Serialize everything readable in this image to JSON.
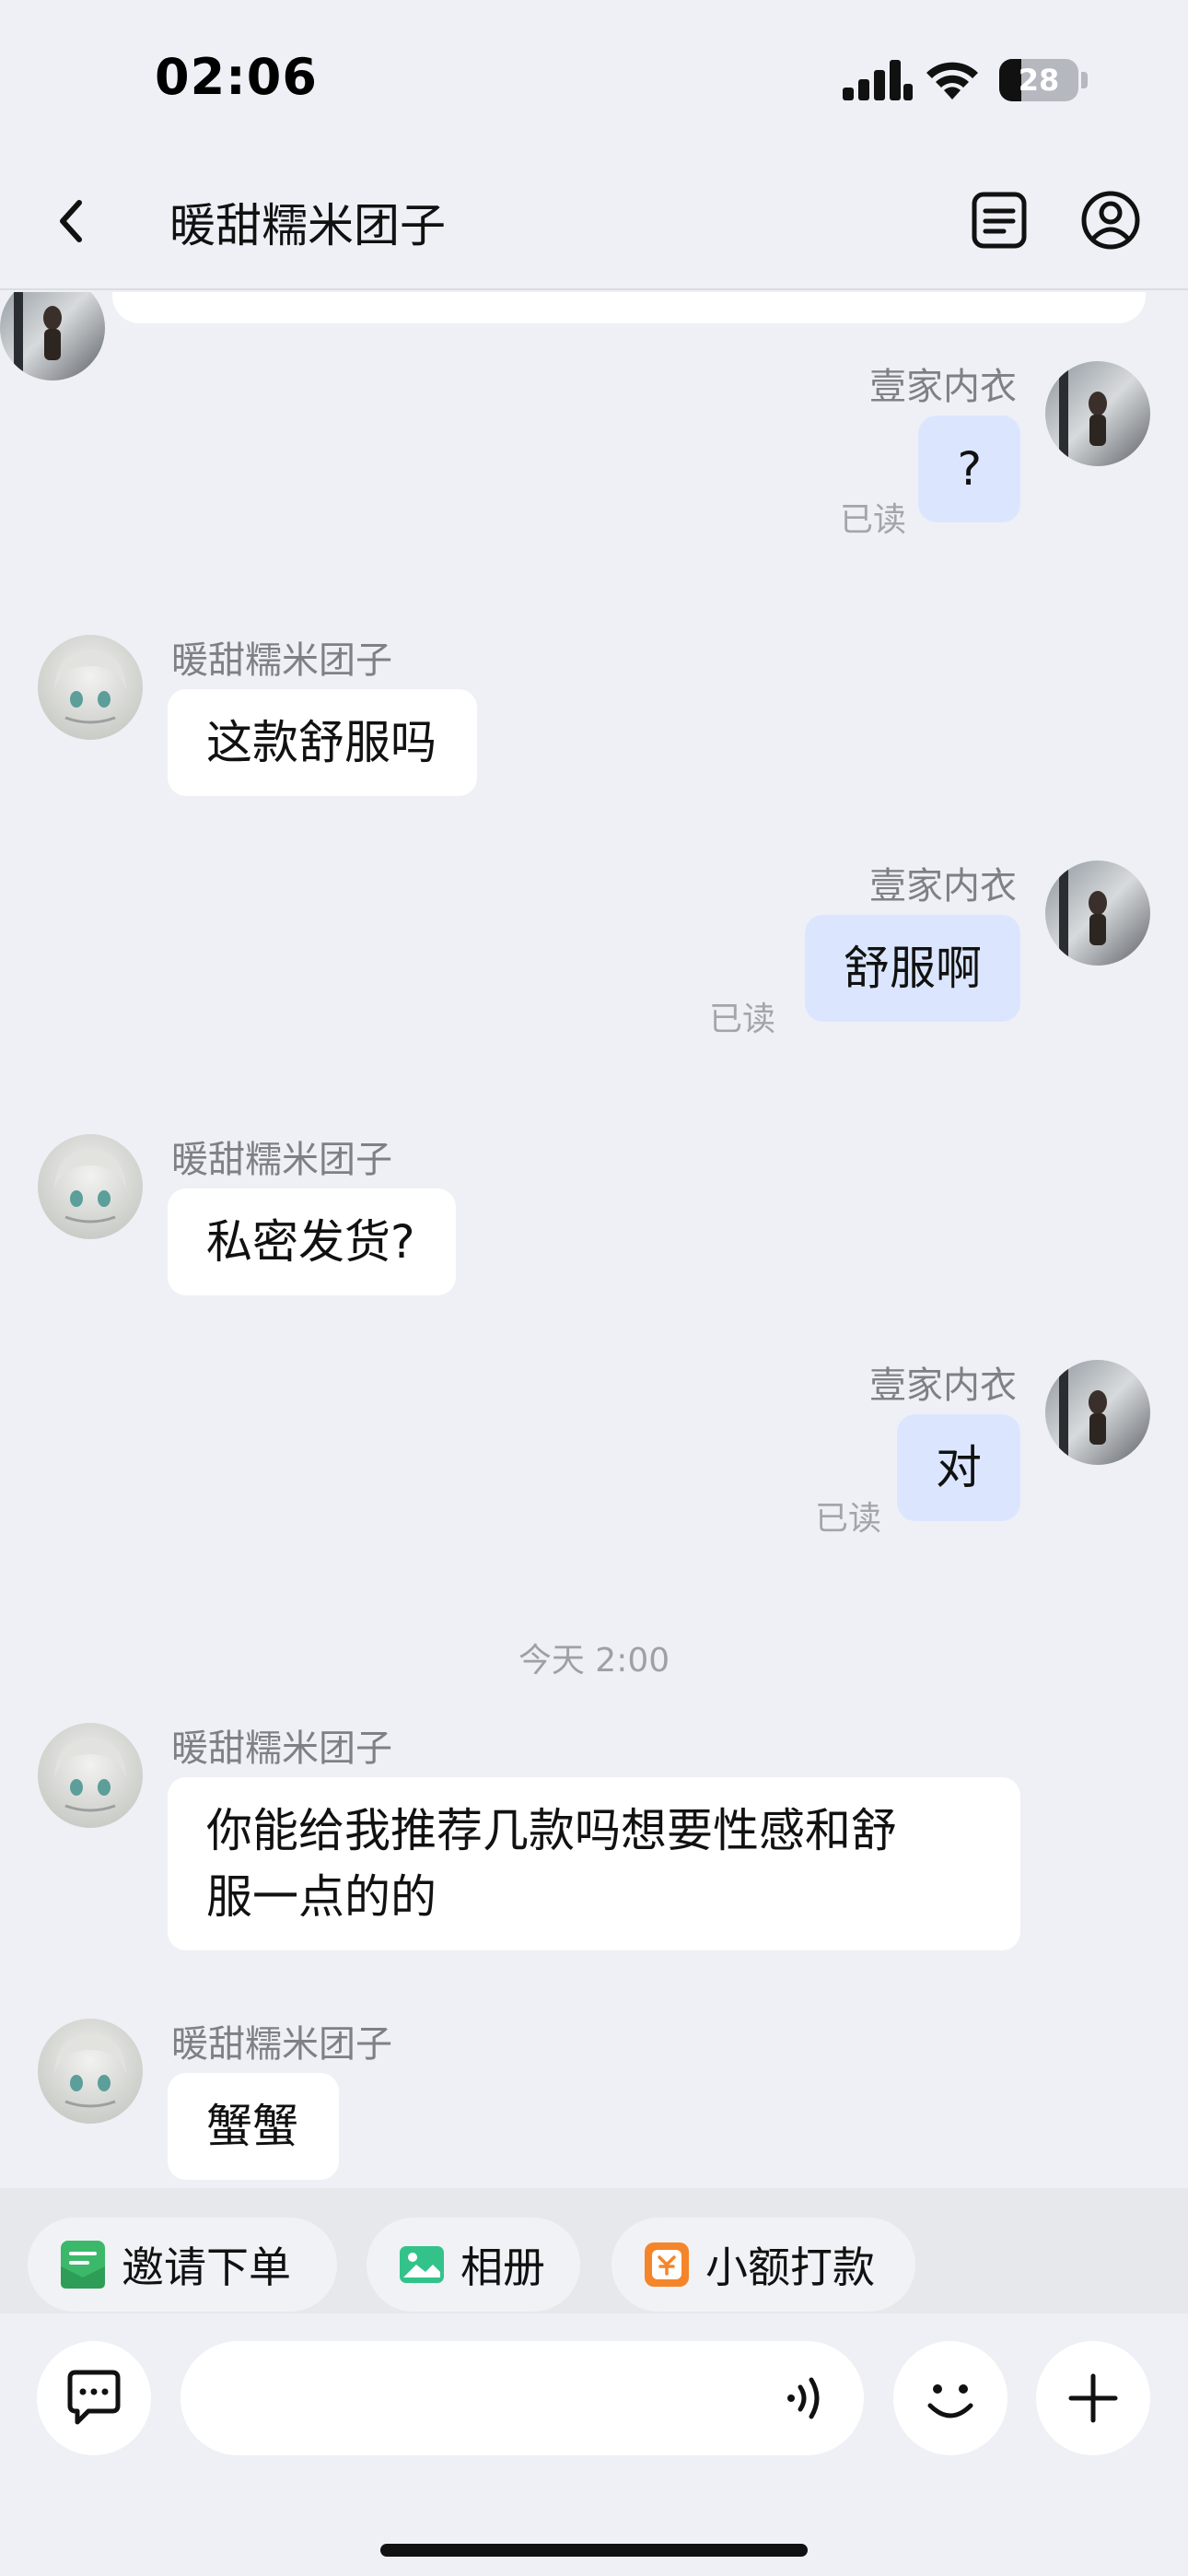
{
  "status_bar": {
    "time": "02:06",
    "battery": "28",
    "battery_level": 0.28
  },
  "header": {
    "title": "暖甜糯米团子"
  },
  "messages": [
    {
      "sender": "壹家内衣",
      "text": "?",
      "read": "已读"
    },
    {
      "sender": "暖甜糯米团子",
      "text": "这款舒服吗"
    },
    {
      "sender": "壹家内衣",
      "text": "舒服啊",
      "read": "已读"
    },
    {
      "sender": "暖甜糯米团子",
      "text": "私密发货?"
    },
    {
      "sender": "壹家内衣",
      "text": "对",
      "read": "已读"
    },
    {
      "sender": "暖甜糯米团子",
      "text_line1": "你能给我推荐几款吗想要性感和舒",
      "text_line2": "服一点的的"
    },
    {
      "sender": "暖甜糯米团子",
      "text": "蟹蟹"
    }
  ],
  "timestamp": "今天 2:00",
  "quick_actions": [
    {
      "label": "邀请下单",
      "icon": "order-invite-icon",
      "color": "#3cb86b"
    },
    {
      "label": "相册",
      "icon": "album-icon",
      "color": "#33c38a"
    },
    {
      "label": "小额打款",
      "icon": "small-payment-icon",
      "color": "#f5852a"
    }
  ],
  "input": {
    "placeholder": ""
  },
  "colors": {
    "background": "#eef0f5",
    "incoming_bubble": "#ffffff",
    "outgoing_bubble": "#dbe6fe",
    "read_status": "#a3a5ab",
    "sender_name": "#7f8086"
  }
}
